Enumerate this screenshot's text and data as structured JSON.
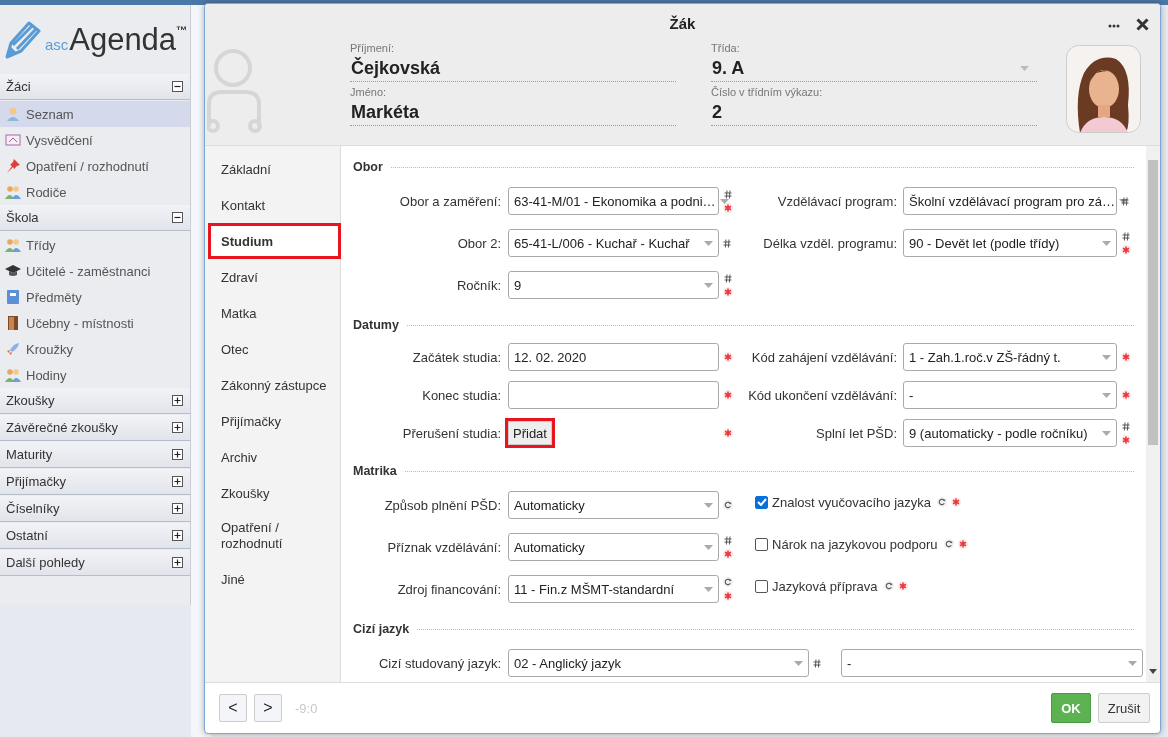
{
  "logo": {
    "prefix": "asc",
    "name": "Agenda",
    "mark": "™"
  },
  "sidebar": [
    {
      "title": "Žáci",
      "expanded": true,
      "items": [
        {
          "label": "Seznam",
          "selected": true
        },
        {
          "label": "Vysvědčení",
          "selected": false
        },
        {
          "label": "Opatření / rozhodnutí",
          "selected": false
        },
        {
          "label": "Rodiče",
          "selected": false
        }
      ]
    },
    {
      "title": "Škola",
      "expanded": true,
      "items": [
        {
          "label": "Třídy",
          "selected": false
        },
        {
          "label": "Učitelé - zaměstnanci",
          "selected": false
        },
        {
          "label": "Předměty",
          "selected": false
        },
        {
          "label": "Učebny - místnosti",
          "selected": false
        },
        {
          "label": "Kroužky",
          "selected": false
        },
        {
          "label": "Hodiny",
          "selected": false
        }
      ]
    },
    {
      "title": "Zkoušky",
      "expanded": false
    },
    {
      "title": "Závěrečné zkoušky",
      "expanded": false
    },
    {
      "title": "Maturity",
      "expanded": false
    },
    {
      "title": "Přijímačky",
      "expanded": false
    },
    {
      "title": "Číselníky",
      "expanded": false
    },
    {
      "title": "Ostatní",
      "expanded": false
    },
    {
      "title": "Další pohledy",
      "expanded": false
    }
  ],
  "dialog": {
    "title": "Žák",
    "header_fields": [
      {
        "label": "Příjmení:",
        "value": "Čejkovská",
        "kind": "text"
      },
      {
        "label": "Třída:",
        "value": "9. A",
        "kind": "select"
      },
      {
        "label": "Jméno:",
        "value": "Markéta",
        "kind": "text"
      },
      {
        "label": "Číslo v třídním výkazu:",
        "value": "2",
        "kind": "text"
      }
    ],
    "tabs": [
      {
        "label": "Základní",
        "selected": false,
        "highlighted": false
      },
      {
        "label": "Kontakt",
        "selected": false,
        "highlighted": false
      },
      {
        "label": "Studium",
        "selected": true,
        "highlighted": true
      },
      {
        "label": "Zdraví",
        "selected": false,
        "highlighted": false
      },
      {
        "label": "Matka",
        "selected": false,
        "highlighted": false
      },
      {
        "label": "Otec",
        "selected": false,
        "highlighted": false
      },
      {
        "label": "Zákonný zástupce",
        "selected": false,
        "highlighted": false
      },
      {
        "label": "Přijímačky",
        "selected": false,
        "highlighted": false
      },
      {
        "label": "Archiv",
        "selected": false,
        "highlighted": false
      },
      {
        "label": "Zkoušky",
        "selected": false,
        "highlighted": false
      },
      {
        "label": "Opatření / rozhodnutí",
        "selected": false,
        "highlighted": false
      },
      {
        "label": "Jiné",
        "selected": false,
        "highlighted": false
      }
    ],
    "sections": [
      {
        "title": "Obor",
        "rows": [
          {
            "kind": "normal",
            "left": {
              "kind": "select",
              "label": "Obor a zaměření:",
              "value": "63-41-M/01 - Ekonomika a podni…",
              "reset": false,
              "hash": true,
              "required": true
            },
            "right": {
              "kind": "select",
              "label": "Vzdělávací program:",
              "value": "Školní vzdělávací program pro zá…",
              "reset": false,
              "hash": true,
              "required": false
            }
          },
          {
            "kind": "normal",
            "left": {
              "kind": "select",
              "label": "Obor 2:",
              "value": "65-41-L/006 - Kuchař - Kuchař",
              "reset": false,
              "hash": true,
              "required": false
            },
            "right": {
              "kind": "select",
              "label": "Délka vzděl. programu:",
              "value": "90 - Devět let (podle třídy)",
              "reset": false,
              "hash": true,
              "required": true
            }
          },
          {
            "kind": "normal",
            "left": {
              "kind": "select",
              "label": "Ročník:",
              "value": "9",
              "reset": false,
              "hash": true,
              "required": true
            }
          }
        ]
      },
      {
        "title": "Datumy",
        "rows": [
          {
            "kind": "compact",
            "left": {
              "kind": "text",
              "label": "Začátek studia:",
              "value": "12. 02. 2020",
              "reset": false,
              "hash": false,
              "required": true
            },
            "right": {
              "kind": "select",
              "label": "Kód zahájení vzdělávání:",
              "value": "1 - Zah.1.roč.v ZŠ-řádný t.",
              "reset": false,
              "hash": false,
              "required": true
            }
          },
          {
            "kind": "compact",
            "left": {
              "kind": "text",
              "label": "Konec studia:",
              "reset": false,
              "hash": false,
              "required": true
            },
            "right": {
              "kind": "select",
              "label": "Kód ukončení vzdělávání:",
              "value": "-",
              "reset": false,
              "hash": false,
              "required": true
            }
          },
          {
            "kind": "compact",
            "left": {
              "kind": "button",
              "label": "Přerušení studia:",
              "value": "Přidat",
              "highlighted": true,
              "reset": false,
              "hash": false,
              "required": true
            },
            "right": {
              "kind": "select",
              "label": "Splní let PŠD:",
              "value": "9 (automaticky - podle ročníku)",
              "reset": false,
              "hash": true,
              "required": true
            }
          }
        ]
      },
      {
        "title": "Matrika",
        "rows": [
          {
            "kind": "normal",
            "left": {
              "kind": "select",
              "label": "Způsob plnění PŠD:",
              "value": "Automaticky",
              "reset": true,
              "hash": false,
              "required": false
            },
            "right": {
              "kind": "checkbox",
              "label": "Znalost vyučovacího jazyka",
              "checked": true,
              "reset": true,
              "hash": false,
              "required": true
            }
          },
          {
            "kind": "normal",
            "left": {
              "kind": "select",
              "label": "Příznak vzdělávání:",
              "value": "Automaticky",
              "reset": false,
              "hash": true,
              "required": true
            },
            "right": {
              "kind": "checkbox",
              "label": "Nárok na jazykovou podporu",
              "checked": false,
              "reset": true,
              "hash": false,
              "required": true
            }
          },
          {
            "kind": "normal",
            "left": {
              "kind": "select",
              "label": "Zdroj financování:",
              "value": "11 - Fin.z MŠMT-standardní",
              "reset": true,
              "hash": false,
              "required": true
            },
            "right": {
              "kind": "checkbox",
              "label": "Jazyková příprava",
              "checked": false,
              "reset": true,
              "hash": false,
              "required": true
            }
          }
        ]
      },
      {
        "title": "Cizí jazyk",
        "rows": [
          {
            "kind": "wide",
            "left": {
              "kind": "select",
              "label": "Cizí studovaný jazyk:",
              "value": "02 - Anglický jazyk",
              "reset": false,
              "hash": true,
              "required": false
            },
            "right": {
              "kind": "select",
              "value": "-",
              "reset": false,
              "hash": false,
              "required": false
            }
          }
        ]
      }
    ],
    "footer": {
      "prev": "<",
      "next": ">",
      "position": "-9:0",
      "ok": "OK",
      "cancel": "Zrušit"
    }
  }
}
